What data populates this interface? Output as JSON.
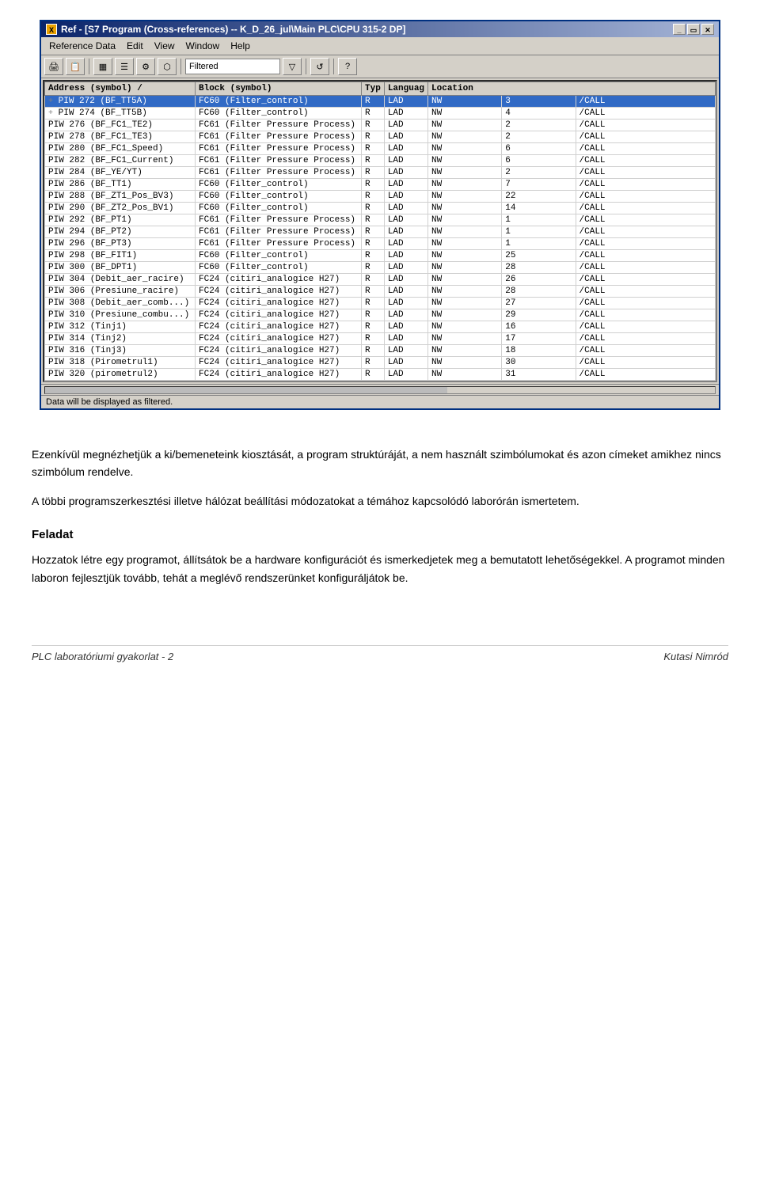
{
  "window": {
    "title": "Ref - [S7 Program (Cross-references) -- K_D_26_jul\\Main PLC\\CPU 315-2 DP]",
    "icon": "X",
    "menu": [
      "Reference Data",
      "Edit",
      "View",
      "Window",
      "Help"
    ],
    "toolbar": {
      "filter_label": "Filtered",
      "buttons": [
        "print",
        "copy",
        "table",
        "list",
        "properties",
        "io",
        "filter",
        "refresh",
        "help"
      ]
    }
  },
  "table": {
    "columns": [
      "Address (symbol)",
      "Block (symbol)",
      "Typ",
      "Languag",
      "Location"
    ],
    "rows": [
      {
        "expand": "+",
        "address": "PIW 272 (BF_TT5A)",
        "block": "FC60 (Filter_control)",
        "typ": "R",
        "lang": "LAD",
        "loc1": "NW",
        "loc2": "3",
        "loc3": "/CALL",
        "highlight": true
      },
      {
        "expand": "+",
        "address": "PIW 274 (BF_TT5B)",
        "block": "FC60 (Filter_control)",
        "typ": "R",
        "lang": "LAD",
        "loc1": "NW",
        "loc2": "4",
        "loc3": "/CALL"
      },
      {
        "expand": "",
        "address": "PIW 276 (BF_FC1_TE2)",
        "block": "FC61 (Filter Pressure Process)",
        "typ": "R",
        "lang": "LAD",
        "loc1": "NW",
        "loc2": "2",
        "loc3": "/CALL"
      },
      {
        "expand": "",
        "address": "PIW 278 (BF_FC1_TE3)",
        "block": "FC61 (Filter Pressure Process)",
        "typ": "R",
        "lang": "LAD",
        "loc1": "NW",
        "loc2": "2",
        "loc3": "/CALL"
      },
      {
        "expand": "",
        "address": "PIW 280 (BF_FC1_Speed)",
        "block": "FC61 (Filter Pressure Process)",
        "typ": "R",
        "lang": "LAD",
        "loc1": "NW",
        "loc2": "6",
        "loc3": "/CALL"
      },
      {
        "expand": "",
        "address": "PIW 282 (BF_FC1_Current)",
        "block": "FC61 (Filter Pressure Process)",
        "typ": "R",
        "lang": "LAD",
        "loc1": "NW",
        "loc2": "6",
        "loc3": "/CALL"
      },
      {
        "expand": "",
        "address": "PIW 284 (BF_YE/YT)",
        "block": "FC61 (Filter Pressure Process)",
        "typ": "R",
        "lang": "LAD",
        "loc1": "NW",
        "loc2": "2",
        "loc3": "/CALL"
      },
      {
        "expand": "",
        "address": "PIW 286 (BF_TT1)",
        "block": "FC60 (Filter_control)",
        "typ": "R",
        "lang": "LAD",
        "loc1": "NW",
        "loc2": "7",
        "loc3": "/CALL"
      },
      {
        "expand": "",
        "address": "PIW 288 (BF_ZT1_Pos_BV3)",
        "block": "FC60 (Filter_control)",
        "typ": "R",
        "lang": "LAD",
        "loc1": "NW",
        "loc2": "22",
        "loc3": "/CALL"
      },
      {
        "expand": "",
        "address": "PIW 290 (BF_ZT2_Pos_BV1)",
        "block": "FC60 (Filter_control)",
        "typ": "R",
        "lang": "LAD",
        "loc1": "NW",
        "loc2": "14",
        "loc3": "/CALL"
      },
      {
        "expand": "",
        "address": "PIW 292 (BF_PT1)",
        "block": "FC61 (Filter Pressure Process)",
        "typ": "R",
        "lang": "LAD",
        "loc1": "NW",
        "loc2": "1",
        "loc3": "/CALL"
      },
      {
        "expand": "",
        "address": "PIW 294 (BF_PT2)",
        "block": "FC61 (Filter Pressure Process)",
        "typ": "R",
        "lang": "LAD",
        "loc1": "NW",
        "loc2": "1",
        "loc3": "/CALL"
      },
      {
        "expand": "",
        "address": "PIW 296 (BF_PT3)",
        "block": "FC61 (Filter Pressure Process)",
        "typ": "R",
        "lang": "LAD",
        "loc1": "NW",
        "loc2": "1",
        "loc3": "/CALL"
      },
      {
        "expand": "",
        "address": "PIW 298 (BF_FIT1)",
        "block": "FC60 (Filter_control)",
        "typ": "R",
        "lang": "LAD",
        "loc1": "NW",
        "loc2": "25",
        "loc3": "/CALL"
      },
      {
        "expand": "",
        "address": "PIW 300 (BF_DPT1)",
        "block": "FC60 (Filter_control)",
        "typ": "R",
        "lang": "LAD",
        "loc1": "NW",
        "loc2": "28",
        "loc3": "/CALL"
      },
      {
        "expand": "",
        "address": "PIW 304 (Debit_aer_racire)",
        "block": "FC24 (citiri_analogice H27)",
        "typ": "R",
        "lang": "LAD",
        "loc1": "NW",
        "loc2": "26",
        "loc3": "/CALL"
      },
      {
        "expand": "",
        "address": "PIW 306 (Presiune_racire)",
        "block": "FC24 (citiri_analogice H27)",
        "typ": "R",
        "lang": "LAD",
        "loc1": "NW",
        "loc2": "28",
        "loc3": "/CALL"
      },
      {
        "expand": "",
        "address": "PIW 308 (Debit_aer_comb...)",
        "block": "FC24 (citiri_analogice H27)",
        "typ": "R",
        "lang": "LAD",
        "loc1": "NW",
        "loc2": "27",
        "loc3": "/CALL"
      },
      {
        "expand": "",
        "address": "PIW 310 (Presiune_combu...)",
        "block": "FC24 (citiri_analogice H27)",
        "typ": "R",
        "lang": "LAD",
        "loc1": "NW",
        "loc2": "29",
        "loc3": "/CALL"
      },
      {
        "expand": "",
        "address": "PIW 312 (Tinj1)",
        "block": "FC24 (citiri_analogice H27)",
        "typ": "R",
        "lang": "LAD",
        "loc1": "NW",
        "loc2": "16",
        "loc3": "/CALL"
      },
      {
        "expand": "",
        "address": "PIW 314 (Tinj2)",
        "block": "FC24 (citiri_analogice H27)",
        "typ": "R",
        "lang": "LAD",
        "loc1": "NW",
        "loc2": "17",
        "loc3": "/CALL"
      },
      {
        "expand": "",
        "address": "PIW 316 (Tinj3)",
        "block": "FC24 (citiri_analogice H27)",
        "typ": "R",
        "lang": "LAD",
        "loc1": "NW",
        "loc2": "18",
        "loc3": "/CALL"
      },
      {
        "expand": "",
        "address": "PIW 318 (Pirometrul1)",
        "block": "FC24 (citiri_analogice H27)",
        "typ": "R",
        "lang": "LAD",
        "loc1": "NW",
        "loc2": "30",
        "loc3": "/CALL"
      },
      {
        "expand": "",
        "address": "PIW 320 (pirometrul2)",
        "block": "FC24 (citiri_analogice H27)",
        "typ": "R",
        "lang": "LAD",
        "loc1": "NW",
        "loc2": "31",
        "loc3": "/CALL"
      }
    ],
    "status": "Data will be displayed as filtered."
  },
  "content": {
    "para1": "Ezenkívül megnézhetjük a ki/bemeneteink kiosztását, a program struktúráját, a nem használt szimbólumokat és azon címeket amikhez nincs szimbólum rendelve.",
    "para2": "A többi programszerkesztési illetve hálózat beállítási módozatokat a témához kapcsolódó laborórán ismertetem.",
    "section_title": "Feladat",
    "para3": "Hozzatok létre egy programot, állítsátok be a hardware konfigurációt és ismerkedjetek meg a bemutatott lehetőségekkel. A programot minden laboron fejlesztjük tovább, tehát a meglévő rendszerünket konfiguráljátok be."
  },
  "footer": {
    "left": "PLC laboratóriumi gyakorlat - 2",
    "right": "Kutasi Nimród"
  }
}
